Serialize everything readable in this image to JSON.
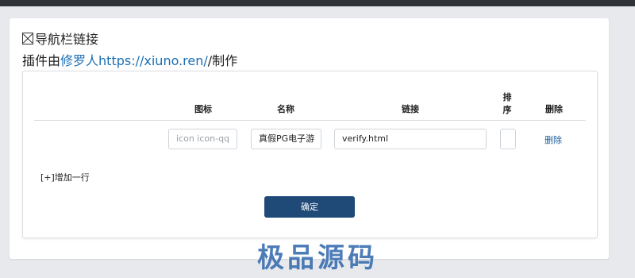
{
  "header": {
    "title": "导航栏链接",
    "credit_prefix": "插件由",
    "credit_author": "修罗人",
    "credit_url": "https://xiuno.ren/",
    "credit_suffix": "/制作"
  },
  "table": {
    "columns": {
      "icon": "图标",
      "name": "名称",
      "link": "链接",
      "order_1": "排",
      "order_2": "序",
      "delete": "删除"
    },
    "rows": [
      {
        "icon_placeholder": "icon icon-qq",
        "icon_value": "",
        "name": "真假PG电子游",
        "link": "verify.html",
        "order": "",
        "delete_label": "删除"
      }
    ]
  },
  "actions": {
    "add_row": "[+]增加一行",
    "confirm": "确定"
  },
  "watermark": "极品源码",
  "colors": {
    "link": "#1a6fb5",
    "confirm_bg": "#1f4a78",
    "watermark": "#3a6fb0"
  }
}
